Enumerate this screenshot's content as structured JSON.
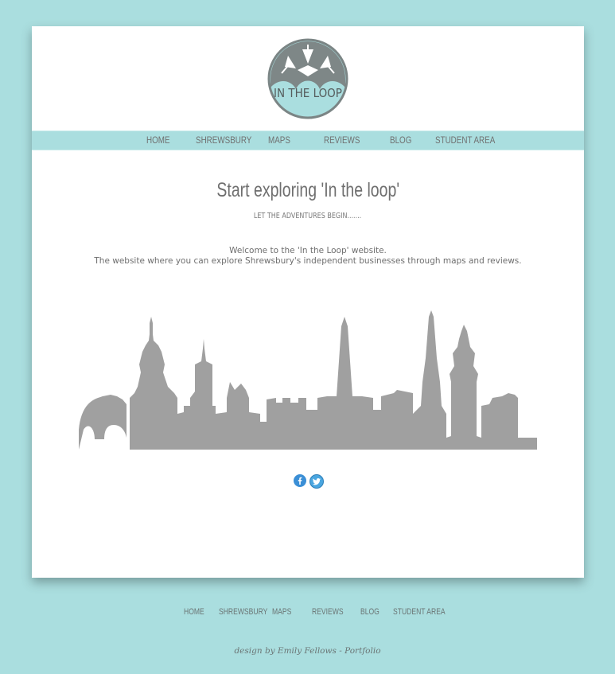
{
  "logo": {
    "text": "IN THE LOOP"
  },
  "nav": [
    "HOME",
    "SHREWSBURY",
    "MAPS",
    "REVIEWS",
    "BLOG",
    "STUDENT AREA"
  ],
  "main": {
    "headline": "Start exploring 'In the loop'",
    "tagline": "LET THE ADVENTURES BEGIN.......",
    "intro_line1": "Welcome to the 'In the Loop' website.",
    "intro_line2": "The website where you can explore Shrewsbury's independent businesses through maps and reviews."
  },
  "social": {
    "facebook_icon": "f",
    "twitter_icon": "bird"
  },
  "footer": {
    "nav": [
      "HOME",
      "SHREWSBURY",
      "MAPS",
      "REVIEWS",
      "BLOG",
      "STUDENT AREA"
    ],
    "credit": "design by Emily Fellows - Portfolio"
  },
  "colors": {
    "background": "#aadedf",
    "page": "#ffffff",
    "text": "#6e6e6e",
    "skyline": "#a0a0a0",
    "facebook": "#3b8fd6",
    "twitter": "#4aa6e0"
  }
}
